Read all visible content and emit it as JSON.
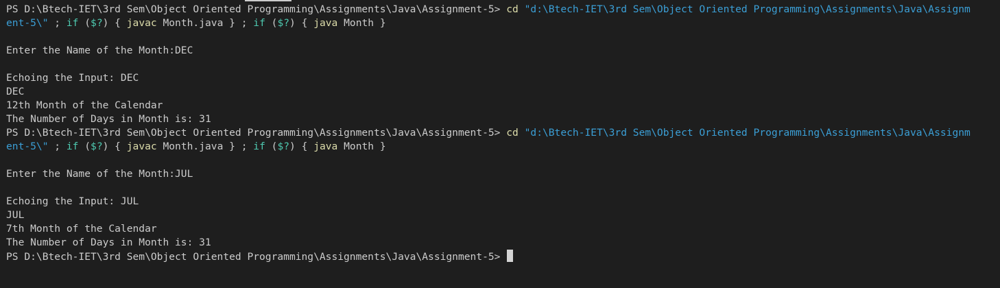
{
  "terminal": {
    "prompt": "PS D:\\Btech-IET\\3rd Sem\\Object Oriented Programming\\Assignments\\Java\\Assignment-5> ",
    "cmd_cd": "cd",
    "path_part1": " \"d:\\Btech-IET\\3rd Sem\\Object Oriented Programming\\Assignments\\Java\\Assignm",
    "path_part2": "ent-5\\\"",
    "sep1": " ; ",
    "kw_if": "if",
    "cond_open": " (",
    "cond_var": "$?",
    "cond_close": ") { ",
    "cmd_javac": "javac",
    "javac_arg": " Month.java } ",
    "sep2": "; ",
    "cmd_java": "java",
    "java_arg": " Month }",
    "run1": {
      "input_prompt": "Enter the Name of the Month:DEC",
      "echo": "Echoing the Input: DEC",
      "upper": "DEC",
      "position": "12th Month of the Calendar",
      "days": "The Number of Days in Month is: 31"
    },
    "run2": {
      "input_prompt": "Enter the Name of the Month:JUL",
      "echo": "Echoing the Input: JUL",
      "upper": "JUL",
      "position": "7th Month of the Calendar",
      "days": "The Number of Days in Month is: 31"
    }
  },
  "colors": {
    "background": "#1e1e1e",
    "text": "#cccccc",
    "command": "#dcdcaa",
    "string": "#3b9fd6",
    "keyword": "#4ec9b0"
  }
}
